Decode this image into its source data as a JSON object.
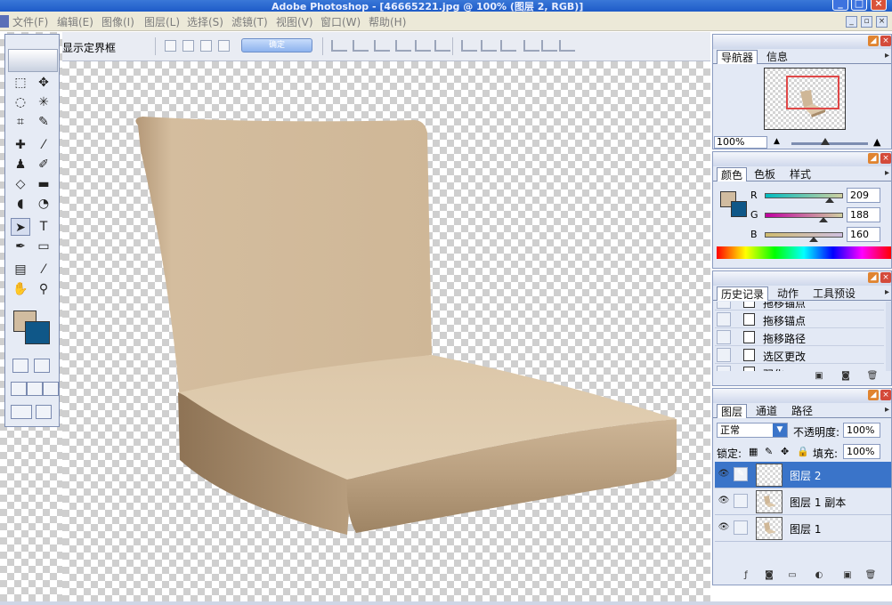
{
  "window": {
    "title": "Adobe Photoshop - [46665221.jpg @ 100% (图层 2, RGB)]",
    "min_label": "_",
    "max_label": "□",
    "close_label": "×"
  },
  "menu": [
    {
      "label": "文件(F)"
    },
    {
      "label": "编辑(E)"
    },
    {
      "label": "图像(I)"
    },
    {
      "label": "图层(L)"
    },
    {
      "label": "选择(S)"
    },
    {
      "label": "滤镜(T)"
    },
    {
      "label": "视图(V)"
    },
    {
      "label": "窗口(W)"
    },
    {
      "label": "帮助(H)"
    }
  ],
  "options_bar": {
    "show_bounding_box_label": "显示定界框",
    "confirm_button": "确定"
  },
  "tools": [
    "marquee-tool",
    "move-tool",
    "lasso-tool",
    "magic-wand-tool",
    "crop-tool",
    "slice-tool",
    "healing-brush-tool",
    "brush-tool",
    "clone-stamp-tool",
    "history-brush-tool",
    "eraser-tool",
    "gradient-tool",
    "blur-tool",
    "dodge-tool",
    "path-selection-tool",
    "type-tool",
    "pen-tool",
    "shape-tool",
    "notes-tool",
    "eyedropper-tool",
    "hand-tool",
    "zoom-tool"
  ],
  "colors": {
    "foreground": "#d1bca0",
    "background": "#0f5788",
    "chair_light": "#d7c3a6",
    "chair_dark": "#a88c6a"
  },
  "navigator": {
    "tabs": [
      "导航器",
      "信息"
    ],
    "zoom": "100%"
  },
  "color_panel": {
    "tabs": [
      "颜色",
      "色板",
      "样式"
    ],
    "channels": [
      {
        "label": "R",
        "value": "209"
      },
      {
        "label": "G",
        "value": "188"
      },
      {
        "label": "B",
        "value": "160"
      }
    ]
  },
  "history": {
    "tabs": [
      "历史记录",
      "动作",
      "工具预设"
    ],
    "items": [
      "拖移锚点",
      "拖移锚点",
      "拖移路径",
      "选区更改",
      "羽化"
    ]
  },
  "layers": {
    "tabs": [
      "图层",
      "通道",
      "路径"
    ],
    "blend_mode": "正常",
    "opacity_label": "不透明度:",
    "opacity": "100%",
    "lock_label": "锁定:",
    "fill_label": "填充:",
    "fill": "100%",
    "items": [
      {
        "name": "图层 2",
        "selected": true
      },
      {
        "name": "图层 1 副本",
        "selected": false
      },
      {
        "name": "图层 1",
        "selected": false
      }
    ]
  }
}
